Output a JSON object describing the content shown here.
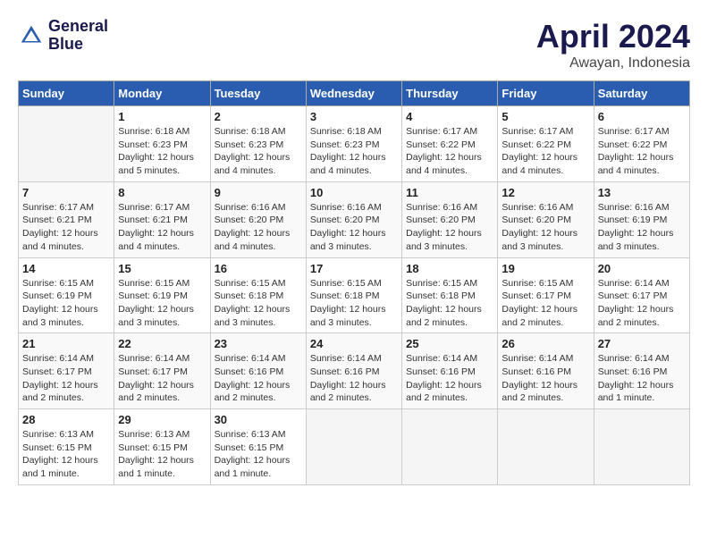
{
  "header": {
    "logo_line1": "General",
    "logo_line2": "Blue",
    "month": "April 2024",
    "location": "Awayan, Indonesia"
  },
  "days_of_week": [
    "Sunday",
    "Monday",
    "Tuesday",
    "Wednesday",
    "Thursday",
    "Friday",
    "Saturday"
  ],
  "weeks": [
    [
      {
        "day": "",
        "info": ""
      },
      {
        "day": "1",
        "info": "Sunrise: 6:18 AM\nSunset: 6:23 PM\nDaylight: 12 hours\nand 5 minutes."
      },
      {
        "day": "2",
        "info": "Sunrise: 6:18 AM\nSunset: 6:23 PM\nDaylight: 12 hours\nand 4 minutes."
      },
      {
        "day": "3",
        "info": "Sunrise: 6:18 AM\nSunset: 6:23 PM\nDaylight: 12 hours\nand 4 minutes."
      },
      {
        "day": "4",
        "info": "Sunrise: 6:17 AM\nSunset: 6:22 PM\nDaylight: 12 hours\nand 4 minutes."
      },
      {
        "day": "5",
        "info": "Sunrise: 6:17 AM\nSunset: 6:22 PM\nDaylight: 12 hours\nand 4 minutes."
      },
      {
        "day": "6",
        "info": "Sunrise: 6:17 AM\nSunset: 6:22 PM\nDaylight: 12 hours\nand 4 minutes."
      }
    ],
    [
      {
        "day": "7",
        "info": "Sunrise: 6:17 AM\nSunset: 6:21 PM\nDaylight: 12 hours\nand 4 minutes."
      },
      {
        "day": "8",
        "info": "Sunrise: 6:17 AM\nSunset: 6:21 PM\nDaylight: 12 hours\nand 4 minutes."
      },
      {
        "day": "9",
        "info": "Sunrise: 6:16 AM\nSunset: 6:20 PM\nDaylight: 12 hours\nand 4 minutes."
      },
      {
        "day": "10",
        "info": "Sunrise: 6:16 AM\nSunset: 6:20 PM\nDaylight: 12 hours\nand 3 minutes."
      },
      {
        "day": "11",
        "info": "Sunrise: 6:16 AM\nSunset: 6:20 PM\nDaylight: 12 hours\nand 3 minutes."
      },
      {
        "day": "12",
        "info": "Sunrise: 6:16 AM\nSunset: 6:20 PM\nDaylight: 12 hours\nand 3 minutes."
      },
      {
        "day": "13",
        "info": "Sunrise: 6:16 AM\nSunset: 6:19 PM\nDaylight: 12 hours\nand 3 minutes."
      }
    ],
    [
      {
        "day": "14",
        "info": "Sunrise: 6:15 AM\nSunset: 6:19 PM\nDaylight: 12 hours\nand 3 minutes."
      },
      {
        "day": "15",
        "info": "Sunrise: 6:15 AM\nSunset: 6:19 PM\nDaylight: 12 hours\nand 3 minutes."
      },
      {
        "day": "16",
        "info": "Sunrise: 6:15 AM\nSunset: 6:18 PM\nDaylight: 12 hours\nand 3 minutes."
      },
      {
        "day": "17",
        "info": "Sunrise: 6:15 AM\nSunset: 6:18 PM\nDaylight: 12 hours\nand 3 minutes."
      },
      {
        "day": "18",
        "info": "Sunrise: 6:15 AM\nSunset: 6:18 PM\nDaylight: 12 hours\nand 2 minutes."
      },
      {
        "day": "19",
        "info": "Sunrise: 6:15 AM\nSunset: 6:17 PM\nDaylight: 12 hours\nand 2 minutes."
      },
      {
        "day": "20",
        "info": "Sunrise: 6:14 AM\nSunset: 6:17 PM\nDaylight: 12 hours\nand 2 minutes."
      }
    ],
    [
      {
        "day": "21",
        "info": "Sunrise: 6:14 AM\nSunset: 6:17 PM\nDaylight: 12 hours\nand 2 minutes."
      },
      {
        "day": "22",
        "info": "Sunrise: 6:14 AM\nSunset: 6:17 PM\nDaylight: 12 hours\nand 2 minutes."
      },
      {
        "day": "23",
        "info": "Sunrise: 6:14 AM\nSunset: 6:16 PM\nDaylight: 12 hours\nand 2 minutes."
      },
      {
        "day": "24",
        "info": "Sunrise: 6:14 AM\nSunset: 6:16 PM\nDaylight: 12 hours\nand 2 minutes."
      },
      {
        "day": "25",
        "info": "Sunrise: 6:14 AM\nSunset: 6:16 PM\nDaylight: 12 hours\nand 2 minutes."
      },
      {
        "day": "26",
        "info": "Sunrise: 6:14 AM\nSunset: 6:16 PM\nDaylight: 12 hours\nand 2 minutes."
      },
      {
        "day": "27",
        "info": "Sunrise: 6:14 AM\nSunset: 6:16 PM\nDaylight: 12 hours\nand 1 minute."
      }
    ],
    [
      {
        "day": "28",
        "info": "Sunrise: 6:13 AM\nSunset: 6:15 PM\nDaylight: 12 hours\nand 1 minute."
      },
      {
        "day": "29",
        "info": "Sunrise: 6:13 AM\nSunset: 6:15 PM\nDaylight: 12 hours\nand 1 minute."
      },
      {
        "day": "30",
        "info": "Sunrise: 6:13 AM\nSunset: 6:15 PM\nDaylight: 12 hours\nand 1 minute."
      },
      {
        "day": "",
        "info": ""
      },
      {
        "day": "",
        "info": ""
      },
      {
        "day": "",
        "info": ""
      },
      {
        "day": "",
        "info": ""
      }
    ]
  ]
}
